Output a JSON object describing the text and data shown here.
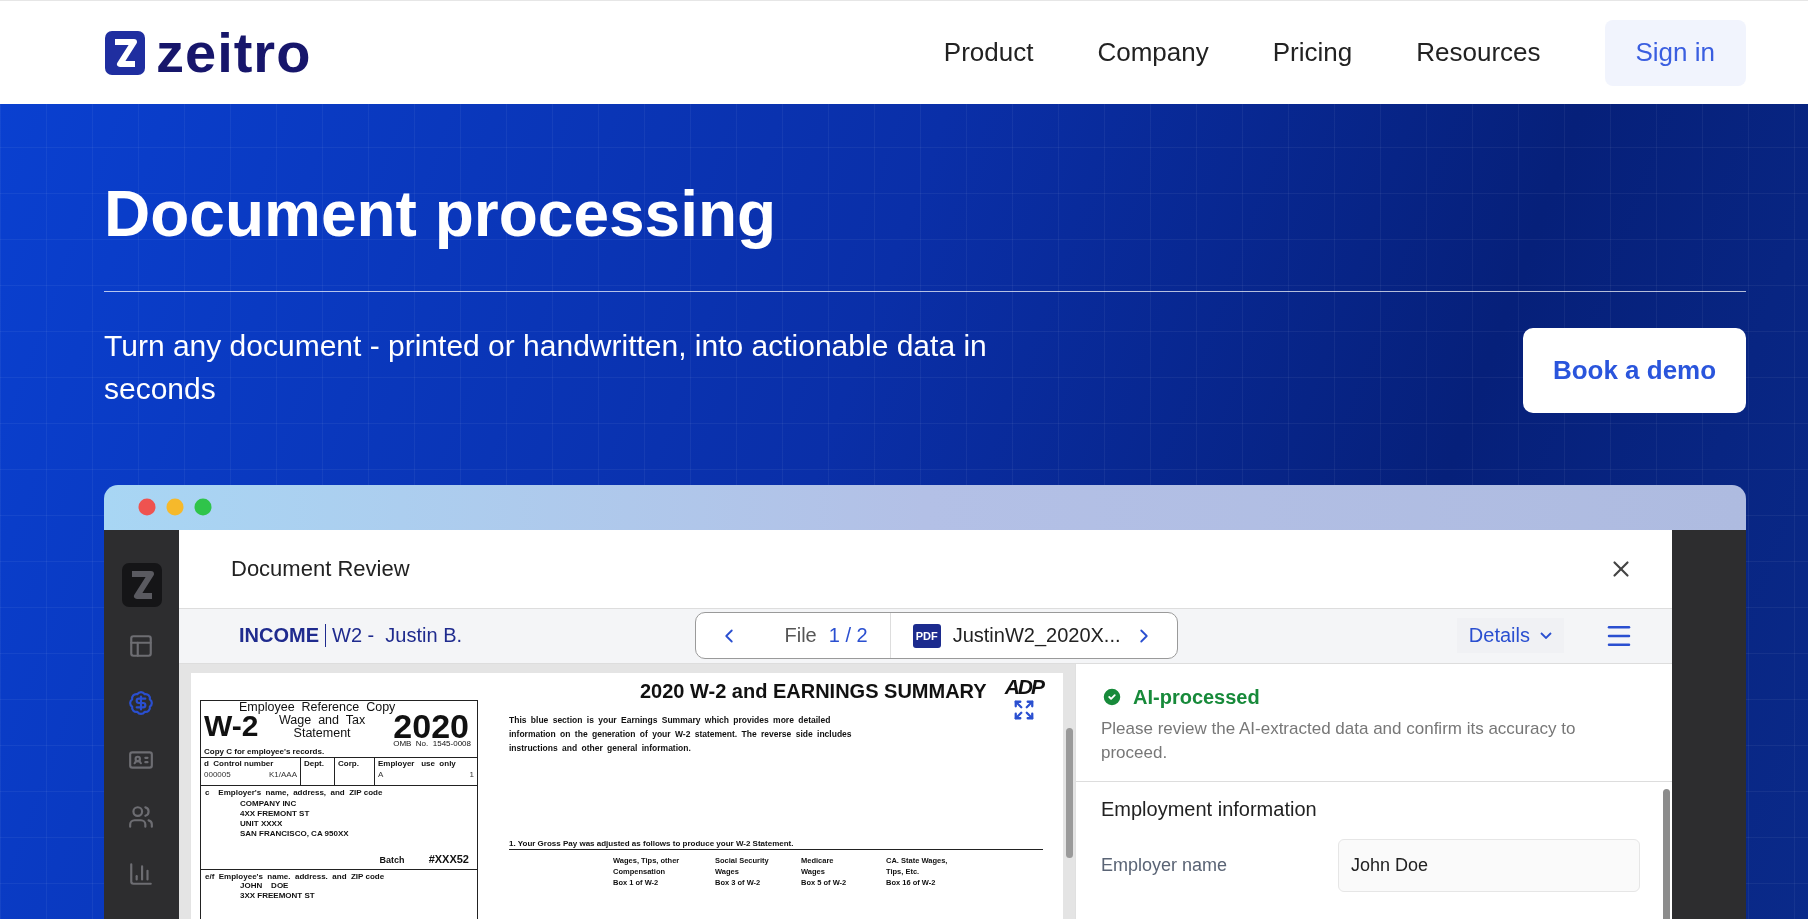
{
  "nav": {
    "logo": "zeitro",
    "items": [
      "Product",
      "Company",
      "Pricing",
      "Resources"
    ],
    "sign_in": "Sign in"
  },
  "hero": {
    "title": "Document processing",
    "subtitle": "Turn any document - printed or handwritten, into actionable data in seconds",
    "cta": "Book a demo"
  },
  "app": {
    "sidebar": [
      {
        "selected": false
      },
      {
        "selected": true
      },
      {
        "selected": false
      },
      {
        "selected": false
      },
      {
        "selected": false
      }
    ],
    "modal_title": "Document Review",
    "breadcrumb": {
      "category": "INCOME",
      "document": "W2 -  Justin B."
    },
    "file_nav": {
      "label": "File",
      "position": "1 / 2",
      "badge": "PDF",
      "file_name": "JustinW2_2020X..."
    },
    "details": "Details",
    "document": {
      "title": "2020 W-2 and EARNINGS SUMMARY",
      "brand": "ADP",
      "form": "W-2",
      "copy_label": "Employee  Reference  Copy",
      "statement": [
        "Wage  and  Tax",
        "Statement"
      ],
      "year": "2020",
      "omb": "OMB  No.  1545-0008",
      "copy_note": "Copy C for employee's records.",
      "cells": [
        {
          "label": "d  Control number",
          "values": [
            "000005",
            "K1/AAA"
          ]
        },
        {
          "label": "Dept."
        },
        {
          "label": "Corp."
        },
        {
          "label": "Employer   use  only",
          "values": [
            "A",
            "1"
          ]
        }
      ],
      "employer": {
        "label": "c    Employer's  name,  address,  and  ZIP code",
        "lines": [
          "COMPANY INC",
          "4XX FREMONT ST",
          "UNIT XXXX",
          "SAN FRANCISCO, CA 950XX"
        ],
        "batch_label": "Batch",
        "batch": "#XXX52"
      },
      "employee": {
        "label": "e/f  Employee's  name.  address.  and  ZIP code",
        "lines": [
          "JOHN    DOE",
          "3XX FREEMONT ST"
        ]
      },
      "intro": "This blue section is your Earnings Summary which provides more detailed information on the generation of your W-2 statement. The reverse side includes instructions and other general information.",
      "gross_pay": "1. Your Gross Pay was adjusted as follows to produce your W-2 Statement.",
      "columns": [
        [
          "Wages, Tips, other",
          "Compensation",
          "Box 1 of W-2"
        ],
        [
          "Social Security",
          "Wages",
          "Box 3 of W-2"
        ],
        [
          "Medicare",
          "Wages",
          "Box 5 of W-2"
        ],
        [
          "CA. State Wages,",
          "Tips, Etc.",
          "Box 16 of W-2"
        ]
      ]
    },
    "status": {
      "label": "AI-processed",
      "message": "Please review the AI-extracted data and confirm its accuracy to proceed."
    },
    "section": "Employment information",
    "fields": [
      {
        "label": "Employer name",
        "value": "John Doe"
      }
    ]
  }
}
